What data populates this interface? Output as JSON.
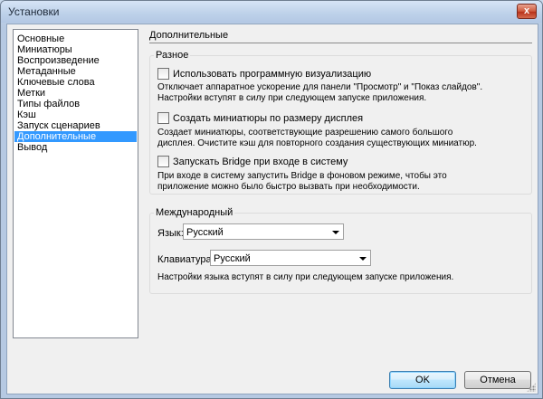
{
  "window": {
    "title": "Установки",
    "close_glyph": "x"
  },
  "sidebar": {
    "items": [
      {
        "label": "Основные"
      },
      {
        "label": "Миниатюры"
      },
      {
        "label": "Воспроизведение"
      },
      {
        "label": "Метаданные"
      },
      {
        "label": "Ключевые слова"
      },
      {
        "label": "Метки"
      },
      {
        "label": "Типы файлов"
      },
      {
        "label": "Кэш"
      },
      {
        "label": "Запуск сценариев"
      },
      {
        "label": "Дополнительные",
        "selected": true
      },
      {
        "label": "Вывод"
      }
    ]
  },
  "page": {
    "title": "Дополнительные"
  },
  "misc_group": {
    "label": "Разное",
    "options": [
      {
        "label": "Использовать программную визуализацию",
        "checked": false,
        "desc_line1": "Отключает аппаратное ускорение для панели \"Просмотр\" и \"Показ слайдов\".",
        "desc_line2": "Настройки вступят в силу при следующем запуске приложения."
      },
      {
        "label": "Создать миниатюры по размеру дисплея",
        "checked": false,
        "desc_line1": "Создает миниатюры, соответствующие разрешению самого большого",
        "desc_line2": "дисплея.  Очистите кэш для повторного создания существующих миниатюр."
      },
      {
        "label": "Запускать Bridge при входе в систему",
        "checked": false,
        "desc_line1": "При входе в систему запустить Bridge в фоновом режиме, чтобы это",
        "desc_line2": "приложение можно было быстро вызвать при необходимости."
      }
    ]
  },
  "intl_group": {
    "label": "Международный",
    "language_label": "Язык:",
    "language_value": "Русский",
    "keyboard_label": "Клавиатура:",
    "keyboard_value": "Русский",
    "note": "Настройки языка вступят в силу при следующем запуске приложения."
  },
  "buttons": {
    "ok": "OK",
    "cancel": "Отмена"
  }
}
